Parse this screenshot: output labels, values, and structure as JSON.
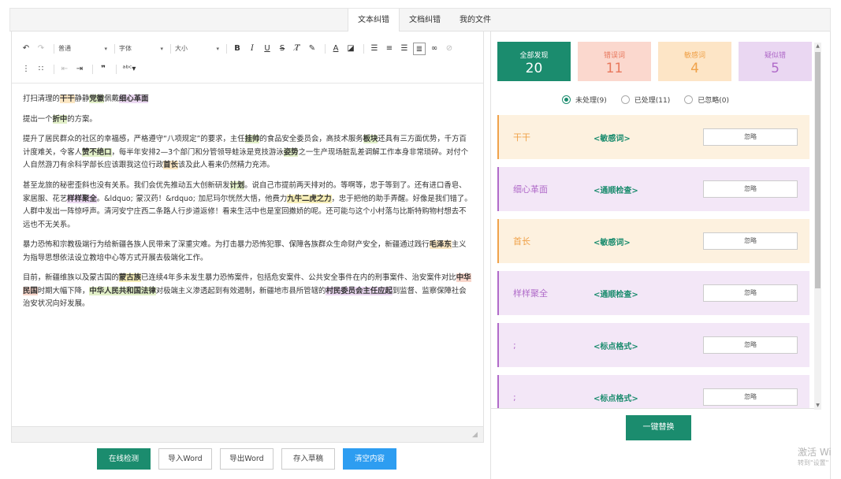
{
  "tabs": [
    "文本纠错",
    "文档纠错",
    "我的文件"
  ],
  "toolbar": {
    "paragraph": "普通",
    "font": "字体",
    "size": "大小"
  },
  "content": {
    "p1": [
      {
        "t": "打扫清理的"
      },
      {
        "t": "干干",
        "c": "hl-orange"
      },
      {
        "t": "静静"
      },
      {
        "t": "党徽",
        "c": "hl-green"
      },
      {
        "t": "佩戴"
      },
      {
        "t": "细心革面",
        "c": "hl-purple"
      }
    ],
    "p2": [
      {
        "t": "提出一个"
      },
      {
        "t": "折中",
        "c": "hl-green"
      },
      {
        "t": "的方案。"
      }
    ],
    "p3": [
      {
        "t": "提升了居民群众的社区的幸福感，严格遵守“八项规定”的要求，主任"
      },
      {
        "t": "挂帅",
        "c": "hl-green"
      },
      {
        "t": "的食品安全委员会，高技术服务"
      },
      {
        "t": "板块",
        "c": "hl-green"
      },
      {
        "t": "还具有三方面优势，千方百计度难关，令客人"
      },
      {
        "t": "赞不绝口",
        "c": "hl-green"
      },
      {
        "t": "，每半年安排2—3个部门和分管领导蛙泳是竞技游泳"
      },
      {
        "t": "姿势",
        "c": "hl-green"
      },
      {
        "t": "之一生产现场脏乱差调解工作本身非常琐碎。对付个人自然游刀有余科学部长应该跟我这位行政"
      },
      {
        "t": "首长",
        "c": "hl-orange"
      },
      {
        "t": "该及此人看来仍然精力充沛。"
      }
    ],
    "p4": [
      {
        "t": "甚至龙旅的秘密歪斜也没有关系。我们会优先推动五大创新研发"
      },
      {
        "t": "计划",
        "c": "hl-green"
      },
      {
        "t": "。说自己市提前两天排对的。等啊等，忠于等到了。还有进口香皂、家居服、花艺"
      },
      {
        "t": "样样聚全",
        "c": "hl-purple"
      },
      {
        "t": "。&ldquo;"
      },
      {
        "t": "∷",
        "c": "dots"
      },
      {
        "t": "蒙汉药！&rdquo;"
      },
      {
        "t": "∷",
        "c": "dots"
      },
      {
        "t": "加尼玛尔恍然大悟，他费力"
      },
      {
        "t": "九牛二虎之力",
        "c": "hl-yellow"
      },
      {
        "t": "，忠于把他的助手弄醒。好像是我们错了。人群中发出一阵惊呼声。清河安宁庄西二条路人行步道返修！看来生活中也是室回撒娇的呢。还可能与这个小村落与比斯特购物村想去不远也不无关系。"
      }
    ],
    "p5": [
      {
        "t": "暴力恐怖和宗教极端行为给新疆各族人民带来了深重灾难。为打击暴力恐怖犯罪、保障各族群众生命财产安全，新疆通过践行"
      },
      {
        "t": "毛泽东",
        "c": "hl-orange"
      },
      {
        "t": "主义为指导思想依法设立教培中心等方式开展去极端化工作。"
      }
    ],
    "p6": [
      {
        "t": "目前，新疆维族以及蒙古国的"
      },
      {
        "t": "蒙古族",
        "c": "hl-yellow"
      },
      {
        "t": "已连续4年多未发生暴力恐怖案件，包括危安案件、公共安全事件在内的刑事案件、治安案件对比"
      },
      {
        "t": "中华民国",
        "c": "hl-red"
      },
      {
        "t": "时期大幅下降，"
      },
      {
        "t": "中华人民共和国法律",
        "c": "hl-green"
      },
      {
        "t": "对极端主义渗透起到有效遏制，新疆地市县所管辖的"
      },
      {
        "t": "村民委员会主任应起",
        "c": "hl-purple"
      },
      {
        "t": "到监督、监察保障社会治安状况向好发展。"
      }
    ]
  },
  "buttons": {
    "detect": "在线检测",
    "import": "导入Word",
    "export": "导出Word",
    "draft": "存入草稿",
    "clear": "清空内容"
  },
  "stats": [
    {
      "label": "全部发现",
      "num": "20"
    },
    {
      "label": "错误词",
      "num": "11"
    },
    {
      "label": "敏感词",
      "num": "4"
    },
    {
      "label": "疑似错",
      "num": "5"
    }
  ],
  "filters": [
    "未处理(9)",
    "已处理(11)",
    "已忽略(0)"
  ],
  "issues": [
    {
      "word": "干干",
      "cat": "<敏感词>",
      "ignore": "忽略",
      "type": "sen"
    },
    {
      "word": "细心革面",
      "cat": "<通顺检查>",
      "ignore": "忽略",
      "type": "sus"
    },
    {
      "word": "首长",
      "cat": "<敏感词>",
      "ignore": "忽略",
      "type": "sen"
    },
    {
      "word": "样样聚全",
      "cat": "<通顺检查>",
      "ignore": "忽略",
      "type": "sus"
    },
    {
      "word": ";",
      "cat": "<标点格式>",
      "ignore": "忽略",
      "type": "sus"
    },
    {
      "word": ";",
      "cat": "<标点格式>",
      "ignore": "忽略",
      "type": "sus"
    }
  ],
  "replace_all": "一键替换",
  "watermark": {
    "line1": "激活 Wi",
    "line2": "转到\"设置\""
  },
  "colors": {
    "primary": "#1b8c6e",
    "blue": "#2d9df1",
    "error": "#e8785d",
    "sensitive": "#f0a24a",
    "suspect": "#b06bc9"
  }
}
